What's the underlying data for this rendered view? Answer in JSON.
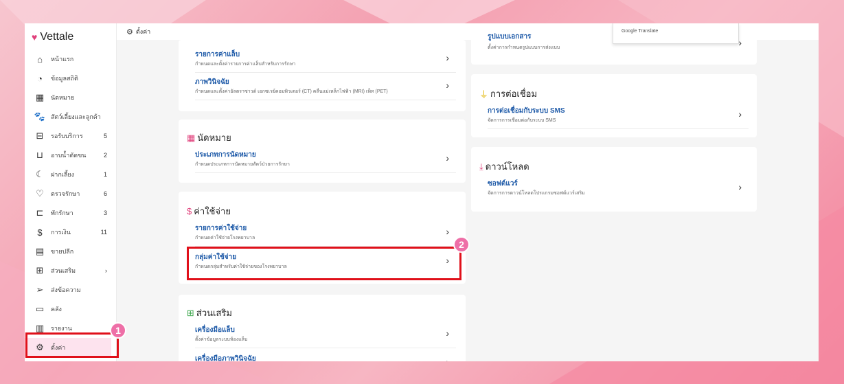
{
  "app": {
    "brand": "Vettale"
  },
  "topbar": {
    "title": "ตั้งค่า"
  },
  "google_translate": {
    "label": "Google Translate"
  },
  "sidebar": {
    "items": [
      {
        "label": "หน้าแรก",
        "icon": "home-icon",
        "glyph": "⌂",
        "count": ""
      },
      {
        "label": "ข้อมูลสถิติ",
        "icon": "stats-icon",
        "glyph": "◔",
        "count": ""
      },
      {
        "label": "นัดหมาย",
        "icon": "calendar-icon",
        "glyph": "▦",
        "count": ""
      },
      {
        "label": "สัตว์เลี้ยงและลูกค้า",
        "icon": "pet-icon",
        "glyph": "🐾",
        "count": ""
      },
      {
        "label": "รอรับบริการ",
        "icon": "sofa-icon",
        "glyph": "⊟",
        "count": "5"
      },
      {
        "label": "อาบน้ำตัดขน",
        "icon": "bath-icon",
        "glyph": "⊔",
        "count": "2"
      },
      {
        "label": "ฝากเลี้ยง",
        "icon": "moon-icon",
        "glyph": "☾",
        "count": "1"
      },
      {
        "label": "ตรวจรักษา",
        "icon": "stethoscope-icon",
        "glyph": "♡",
        "count": "6"
      },
      {
        "label": "พักรักษา",
        "icon": "bed-icon",
        "glyph": "⊏",
        "count": "3"
      },
      {
        "label": "การเงิน",
        "icon": "money-icon",
        "glyph": "$",
        "count": "11"
      },
      {
        "label": "ขายปลีก",
        "icon": "cash-register-icon",
        "glyph": "▤",
        "count": ""
      },
      {
        "label": "ส่วนเสริม",
        "icon": "addon-icon",
        "glyph": "⊞",
        "count": "›"
      },
      {
        "label": "ส่งข้อความ",
        "icon": "send-icon",
        "glyph": "➢",
        "count": ""
      },
      {
        "label": "คลัง",
        "icon": "archive-icon",
        "glyph": "▭",
        "count": ""
      },
      {
        "label": "รายงาน",
        "icon": "report-icon",
        "glyph": "▥",
        "count": ""
      },
      {
        "label": "ตั้งค่า",
        "icon": "gear-icon",
        "glyph": "⚙",
        "count": ""
      }
    ]
  },
  "sections": {
    "top_card": {
      "rows": [
        {
          "title": "รายการค่าแล็บ",
          "subtitle": "กำหนดและตั้งค่ารายการค่าแล็บสำหรับการรักษา"
        },
        {
          "title": "ภาพวินิจฉัย",
          "subtitle": "กำหนดและตั้งค่าอัลตราซาวด์ เอกซเรย์คอมพิวเตอร์ (CT) คลื่นแม่เหล็กไฟฟ้า (MRI) เพ็ท (PET)"
        }
      ]
    },
    "appointment": {
      "title": "นัดหมาย",
      "rows": [
        {
          "title": "ประเภทการนัดหมาย",
          "subtitle": "กำหนดประเภทการนัดหมายสัตว์ป่วยการรักษา"
        }
      ]
    },
    "expense": {
      "title": "ค่าใช้จ่าย",
      "rows": [
        {
          "title": "รายการค่าใช้จ่าย",
          "subtitle": "กำหนดค่าใช้จ่ายโรงพยาบาล"
        },
        {
          "title": "กลุ่มค่าใช้จ่าย",
          "subtitle": "กำหนดกลุ่มสำหรับค่าใช้จ่ายของโรงพยาบาล"
        }
      ]
    },
    "addon": {
      "title": "ส่วนเสริม",
      "rows": [
        {
          "title": "เครื่องมือแล็บ",
          "subtitle": "ตั้งค่าข้อมูลระบบห้องแล็บ"
        },
        {
          "title": "เครื่องมือภาพวินิจฉัย",
          "subtitle": ""
        }
      ]
    },
    "right_top": {
      "rows": [
        {
          "title": "รูปแบบเอกสาร",
          "subtitle": "ตั้งค่าการกำหนดรูปแบบการส่งแบบ"
        }
      ]
    },
    "connection": {
      "title": "การต่อเชื่อม",
      "rows": [
        {
          "title": "การต่อเชื่อมกับระบบ SMS",
          "subtitle": "จัดการการเชื่อมต่อกับระบบ SMS"
        }
      ]
    },
    "download": {
      "title": "ดาวน์โหลด",
      "rows": [
        {
          "title": "ซอฟต์แวร์",
          "subtitle": "จัดการการดาวน์โหลดโปรแกรมซอฟต์แวร์เสริม"
        }
      ]
    }
  },
  "annotations": {
    "badge1": "1",
    "badge2": "2"
  },
  "colors": {
    "accent_pink": "#e0407b",
    "link_blue": "#1e5aa8",
    "highlight_red": "#e0101a",
    "badge_pink": "#ee6fa7"
  },
  "chevron": "›"
}
